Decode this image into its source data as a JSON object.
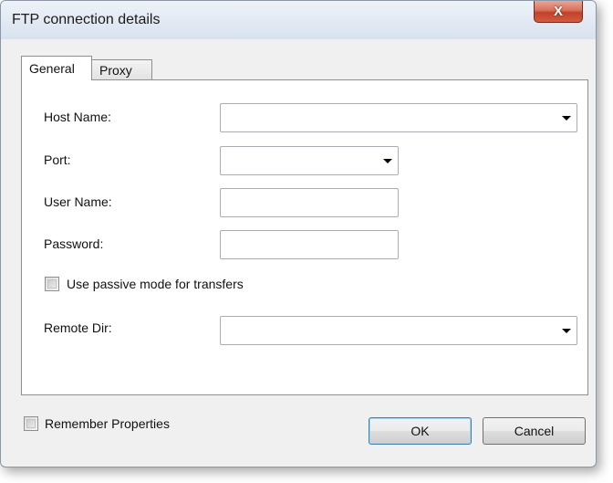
{
  "window": {
    "title": "FTP connection details",
    "close_glyph": "X"
  },
  "tabs": [
    {
      "label": "General",
      "selected": true
    },
    {
      "label": "Proxy",
      "selected": false
    }
  ],
  "form": {
    "host_name_label": "Host Name:",
    "host_name_value": "",
    "port_label": "Port:",
    "port_value": "",
    "user_name_label": "User Name:",
    "user_name_value": "",
    "password_label": "Password:",
    "password_value": "",
    "passive_mode_label": "Use passive mode for transfers",
    "passive_mode_checked": false,
    "remote_dir_label": "Remote Dir:",
    "remote_dir_value": ""
  },
  "footer": {
    "remember_label": "Remember Properties",
    "remember_checked": false,
    "ok_label": "OK",
    "cancel_label": "Cancel"
  },
  "icons": {
    "close": "close-icon",
    "dropdown": "chevron-down-icon"
  },
  "colors": {
    "close_button": "#c2412a",
    "titlebar": "#e3eaf4",
    "default_button_border": "#3c7fb1"
  }
}
